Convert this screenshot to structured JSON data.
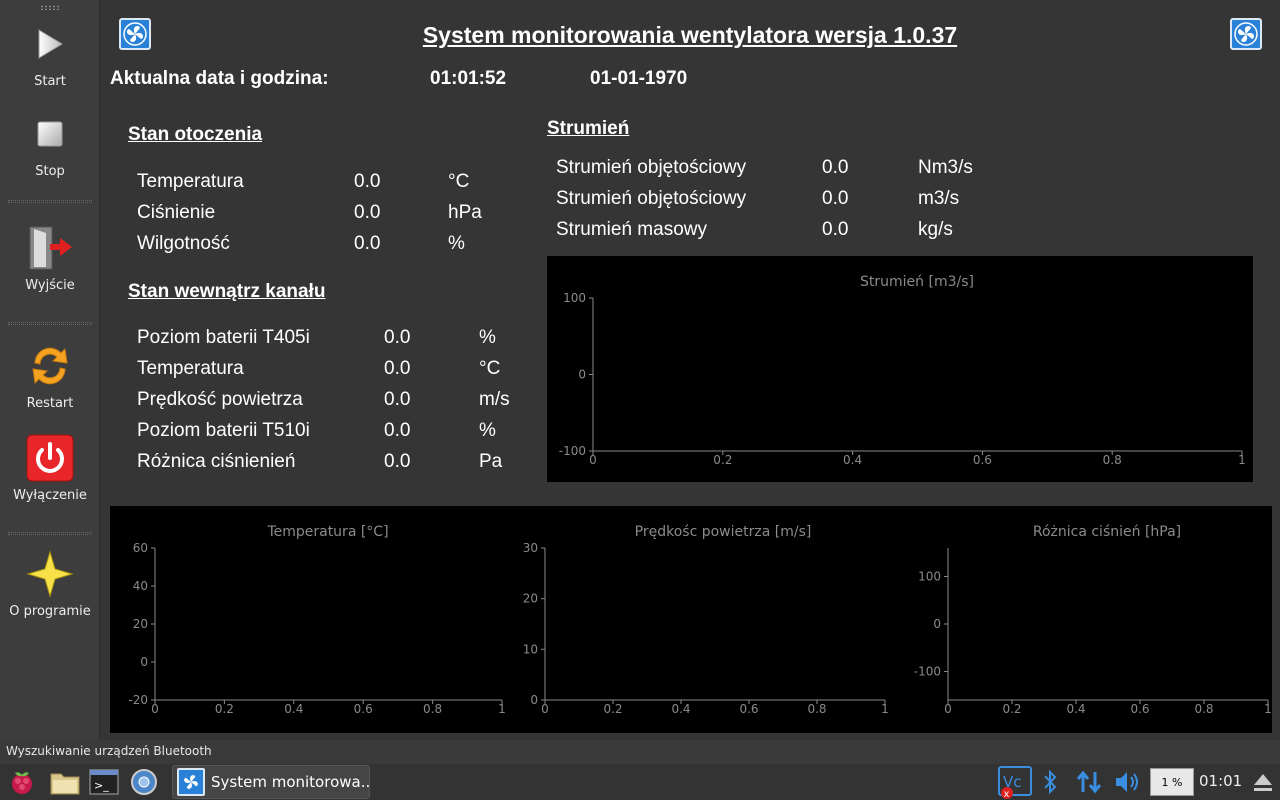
{
  "sidebar": {
    "start": "Start",
    "stop": "Stop",
    "exit": "Wyjście",
    "restart": "Restart",
    "shutdown": "Wyłączenie",
    "about": "O programie"
  },
  "header": {
    "title": "System monitorowania wentylatora wersja 1.0.37",
    "datetime_label": "Aktualna data i godzina:",
    "time": "01:01:52",
    "date": "01-01-1970"
  },
  "ambient": {
    "heading": "Stan otoczenia",
    "rows": [
      {
        "label": "Temperatura",
        "value": "0.0",
        "unit": "°C"
      },
      {
        "label": "Ciśnienie",
        "value": "0.0",
        "unit": "hPa"
      },
      {
        "label": "Wilgotność",
        "value": "0.0",
        "unit": "%"
      }
    ]
  },
  "duct": {
    "heading": "Stan wewnątrz kanału",
    "rows": [
      {
        "label": "Poziom baterii T405i",
        "value": "0.0",
        "unit": "%"
      },
      {
        "label": "Temperatura",
        "value": "0.0",
        "unit": "°C"
      },
      {
        "label": "Prędkość powietrza",
        "value": "0.0",
        "unit": "m/s"
      },
      {
        "label": "Poziom baterii T510i",
        "value": "0.0",
        "unit": "%"
      },
      {
        "label": "Różnica ciśnienień",
        "value": "0.0",
        "unit": "Pa"
      }
    ]
  },
  "flow": {
    "heading": "Strumień",
    "rows": [
      {
        "label": "Strumień objętościowy",
        "value": "0.0",
        "unit": "Nm3/s"
      },
      {
        "label": "Strumień objętościowy",
        "value": "0.0",
        "unit": "m3/s"
      },
      {
        "label": "Strumień masowy",
        "value": "0.0",
        "unit": "kg/s"
      }
    ]
  },
  "chart_data": [
    {
      "type": "line",
      "title": "Strumień [m3/s]",
      "xlim": [
        0,
        1
      ],
      "ylim": [
        -100,
        100
      ],
      "xticks": [
        "0",
        "0.2",
        "0.4",
        "0.6",
        "0.8",
        "1"
      ],
      "yticks": [
        "100",
        "0",
        "-100"
      ],
      "series": []
    },
    {
      "type": "line",
      "title": "Temperatura [°C]",
      "xlim": [
        0,
        1
      ],
      "ylim": [
        -20,
        60
      ],
      "xticks": [
        "0",
        "0.2",
        "0.4",
        "0.6",
        "0.8",
        "1"
      ],
      "yticks": [
        "60",
        "40",
        "20",
        "0",
        "-20"
      ],
      "series": []
    },
    {
      "type": "line",
      "title": "Prędkośc powietrza [m/s]",
      "xlim": [
        0,
        1
      ],
      "ylim": [
        0,
        30
      ],
      "xticks": [
        "0",
        "0.2",
        "0.4",
        "0.6",
        "0.8",
        "1"
      ],
      "yticks": [
        "30",
        "20",
        "10",
        "0"
      ],
      "series": []
    },
    {
      "type": "line",
      "title": "Różnica ciśnień [hPa]",
      "xlim": [
        0,
        1
      ],
      "ylim": [
        -160,
        160
      ],
      "xticks": [
        "0",
        "0.2",
        "0.4",
        "0.6",
        "0.8",
        "1"
      ],
      "yticks": [
        "100",
        "0",
        "-100"
      ],
      "series": []
    }
  ],
  "status": "Wyszukiwanie urządzeń Bluetooth",
  "taskbar": {
    "window_title": "System monitorowa...",
    "cpu": "1 %",
    "clock": "01:01"
  },
  "colors": {
    "background": "#353535",
    "sidebar": "#3d3d3d",
    "chart_bg": "#000000",
    "axis": "#8a8a8a",
    "stop_red": "#e8262a",
    "restart_orange": "#f4a21f"
  }
}
